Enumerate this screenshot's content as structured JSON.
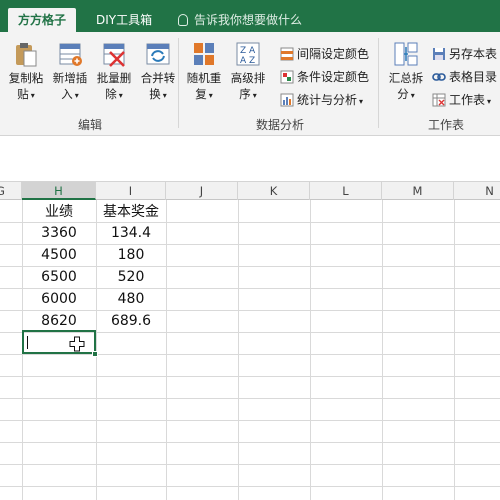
{
  "tabs": {
    "home": "方方格子",
    "diy": "DIY工具箱"
  },
  "tell_me": "告诉我你想要做什么",
  "ribbon": {
    "edit": {
      "copy_paste": [
        "复制粘",
        "贴"
      ],
      "insert": [
        "新增插",
        "入"
      ],
      "batch_delete": [
        "批量删",
        "除"
      ],
      "merge_convert": [
        "合并转",
        "换"
      ],
      "group_label": "编辑"
    },
    "analysis": {
      "random_repeat": [
        "随机重",
        "复"
      ],
      "advanced_sort": [
        "高级排",
        "序"
      ],
      "interval_color": "间隔设定颜色",
      "conditional_color": "条件设定颜色",
      "stats_analysis": "统计与分析",
      "group_label": "数据分析"
    },
    "worksheet": {
      "summary_split": [
        "汇总拆",
        "分"
      ],
      "save_as": "另存本表",
      "table_of_contents": "表格目录",
      "worksheet": "工作表",
      "group_label": "工作表"
    }
  },
  "columns": [
    "G",
    "H",
    "I",
    "J",
    "K",
    "L",
    "M",
    "N"
  ],
  "selected_column": "H",
  "table": {
    "headers": [
      "业绩",
      "基本奖金"
    ],
    "rows": [
      [
        "3360",
        "134.4"
      ],
      [
        "4500",
        "180"
      ],
      [
        "6500",
        "520"
      ],
      [
        "6000",
        "480"
      ],
      [
        "8620",
        "689.6"
      ]
    ]
  },
  "colors": {
    "brand": "#217346",
    "ribbon_bg": "#f3f3f3",
    "grid_line": "#d9d9d9"
  }
}
